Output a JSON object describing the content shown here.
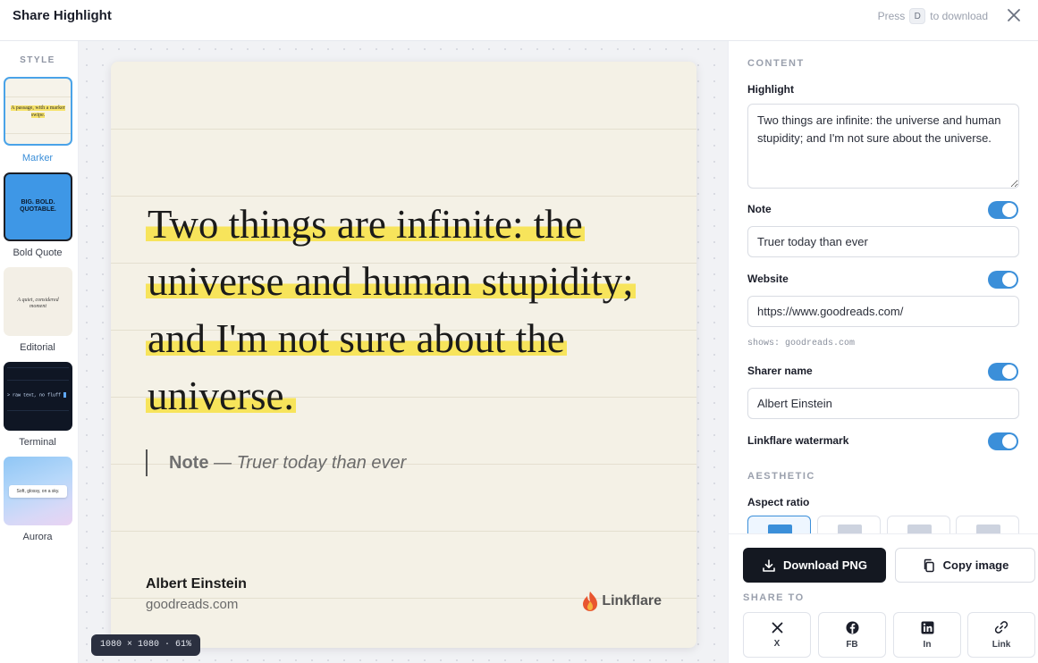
{
  "header": {
    "title": "Share Highlight",
    "hint_prefix": "Press",
    "hint_key": "D",
    "hint_suffix": "to download"
  },
  "styles": {
    "label": "STYLE",
    "items": [
      {
        "name": "Marker",
        "preview": "A passage, with a marker swipe.",
        "active": true
      },
      {
        "name": "Bold Quote",
        "preview": "BIG. BOLD. QUOTABLE.",
        "active": false
      },
      {
        "name": "Editorial",
        "preview": "A quiet, considered moment",
        "active": false
      },
      {
        "name": "Terminal",
        "preview": "> raw text, no fluff",
        "active": false
      },
      {
        "name": "Aurora",
        "preview": "Soft, glossy, on a sky.",
        "active": false
      }
    ]
  },
  "card": {
    "quote": "Two things are infinite: the universe and human stupidity; and I'm not sure about the universe.",
    "note_label": "Note",
    "note_text": "— Truer today than ever",
    "sharer": "Albert Einstein",
    "site": "goodreads.com",
    "brand": "Linkflare",
    "dims": "1080 × 1080 · 61%"
  },
  "panel": {
    "content_label": "CONTENT",
    "highlight_label": "Highlight",
    "highlight_value": "Two things are infinite: the universe and human stupidity; and I'm not sure about the universe.",
    "note_label": "Note",
    "note_value": "Truer today than ever",
    "note_on": true,
    "website_label": "Website",
    "website_value": "https://www.goodreads.com/",
    "website_on": true,
    "shows": "shows: goodreads.com",
    "sharer_label": "Sharer name",
    "sharer_value": "Albert Einstein",
    "sharer_on": true,
    "watermark_label": "Linkflare watermark",
    "watermark_on": true,
    "aesthetic_label": "AESTHETIC",
    "aspect_label": "Aspect ratio"
  },
  "actions": {
    "download": "Download PNG",
    "copy": "Copy image",
    "share_label": "SHARE TO",
    "share": [
      {
        "icon": "x-icon",
        "label": "X"
      },
      {
        "icon": "facebook-icon",
        "label": "FB"
      },
      {
        "icon": "linkedin-icon",
        "label": "In"
      },
      {
        "icon": "link-icon",
        "label": "Link"
      }
    ]
  },
  "colors": {
    "accent": "#3b8fd9",
    "highlight": "#f7e45b",
    "card_bg": "#f4f1e6"
  }
}
